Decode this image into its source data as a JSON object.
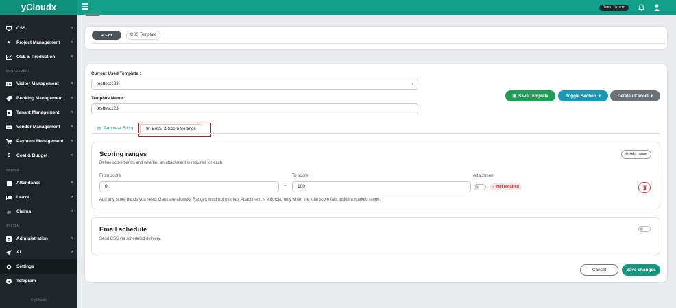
{
  "app": {
    "brand": "yCloudx",
    "demo_badge": "Demo Intern"
  },
  "sidebar": {
    "items": [
      {
        "label": "CSS",
        "icon": "monitor-icon"
      },
      {
        "label": "Project Management",
        "icon": "flag-icon"
      },
      {
        "label": "OEE & Production",
        "icon": "chart-line-icon"
      },
      {
        "label": "Visitor Management",
        "icon": "id-card-icon"
      },
      {
        "label": "Booking Management",
        "icon": "tag-icon"
      },
      {
        "label": "Tenant Management",
        "icon": "building-icon"
      },
      {
        "label": "Vendor Management",
        "icon": "briefcase-icon"
      },
      {
        "label": "Payment Management",
        "icon": "cart-icon"
      },
      {
        "label": "Cost & Budget",
        "icon": "dollar-icon"
      },
      {
        "label": "Attendance",
        "icon": "calendar-icon"
      },
      {
        "label": "Leave",
        "icon": "bed-icon"
      },
      {
        "label": "Claims",
        "icon": "exchange-icon"
      },
      {
        "label": "Administration",
        "icon": "user-box-icon"
      },
      {
        "label": "AI",
        "icon": "send-icon"
      },
      {
        "label": "Settings",
        "icon": "gear-icon"
      },
      {
        "label": "Telegram",
        "icon": "telegram-icon"
      }
    ],
    "sections": {
      "management": "MANAGEMENT",
      "people": "PEOPLE",
      "system": "SYSTEM"
    },
    "footer": "© yCloudx"
  },
  "header": {
    "exit_label": "Exit",
    "breadcrumb": "CSS Template"
  },
  "form": {
    "current_template_label": "Current Used Template :",
    "current_template_value": "testtest123",
    "template_name_label": "Template Name :",
    "template_name_value": "testtest123"
  },
  "actions": {
    "save_template": "Save Template",
    "toggle_section": "Toggle Section",
    "delete_cancel": "Delete / Cancel"
  },
  "tabs": {
    "editor": "Template Editor",
    "email": "Email & Score Settings"
  },
  "scoring": {
    "title": "Scoring ranges",
    "description": "Define score bands and whether an attachment is required for each.",
    "add_range": "Add range",
    "from_label": "From score",
    "to_label": "To score",
    "attachment_label": "Attachment",
    "from_value": "0",
    "to_value": "100",
    "attachment_status": "Not required",
    "note": "Add any score bands you need. Gaps are allowed. Ranges must not overlap. Attachment is enforced only when the total score falls inside a marked range."
  },
  "email_schedule": {
    "title": "Email schedule",
    "description": "Send CSS via scheduled delivery."
  },
  "footer_actions": {
    "cancel": "Cancel",
    "save": "Save changes"
  },
  "colors": {
    "brand": "#12a08a",
    "sidebar": "#1f2629",
    "save_template": "#1f9d57",
    "toggle_section": "#1a97b2",
    "danger": "#d23b3b"
  }
}
